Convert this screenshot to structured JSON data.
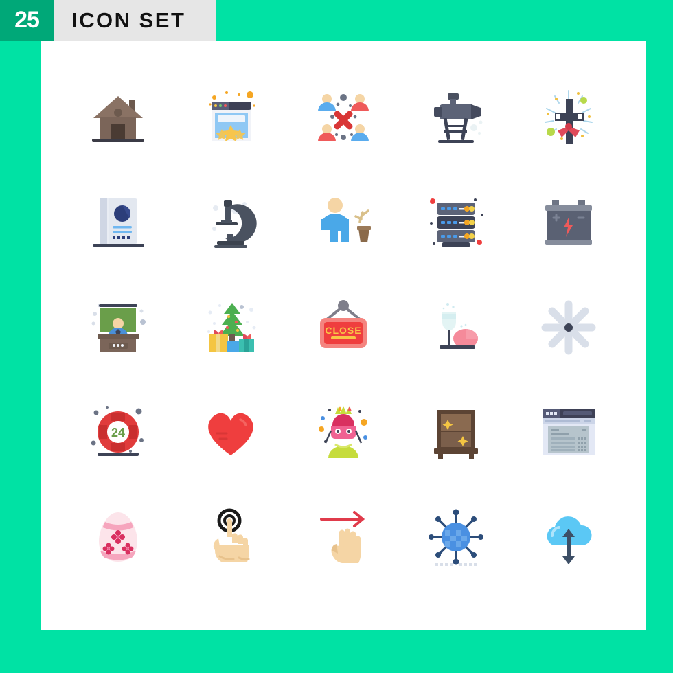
{
  "header": {
    "count": "25",
    "title": "ICON SET",
    "badge_color": "#00a878",
    "band_color": "#e6e6e6",
    "page_background": "#00e2a4",
    "panel_color": "#ffffff"
  },
  "grid": {
    "columns": 5,
    "rows": 5,
    "total": 25,
    "icons": [
      {
        "name": "house-icon",
        "label": "House",
        "colors": [
          "#7b6559",
          "#4a3b33",
          "#3b3b46"
        ]
      },
      {
        "name": "browser-rating-icon",
        "label": "Browser Rating Stars",
        "colors": [
          "#f1f3f8",
          "#3e4156",
          "#6fb7f0",
          "#f7c54d"
        ]
      },
      {
        "name": "group-disconnect-icon",
        "label": "Group Disconnect",
        "colors": [
          "#5aacee",
          "#ef5a5a",
          "#f5d5a5",
          "#d93636"
        ]
      },
      {
        "name": "telescope-icon",
        "label": "Telescope",
        "colors": [
          "#5c6377",
          "#454b5e",
          "#3d4356"
        ]
      },
      {
        "name": "decorated-cross-icon",
        "label": "Decorated Cross",
        "colors": [
          "#3d4356",
          "#e04a5a",
          "#b8d94a",
          "#f0c040"
        ]
      },
      {
        "name": "book-profile-icon",
        "label": "Profile Book",
        "colors": [
          "#cfd6e4",
          "#e3e8f0",
          "#2c3e7a",
          "#6fb7f0"
        ]
      },
      {
        "name": "microscope-icon",
        "label": "Microscope",
        "colors": [
          "#4a5260",
          "#3c434f",
          "#e6ebf2"
        ]
      },
      {
        "name": "person-plant-icon",
        "label": "Person with Plant",
        "colors": [
          "#4aa8e8",
          "#f5d5a5",
          "#8a6a4a",
          "#d9c08a"
        ]
      },
      {
        "name": "server-rack-icon",
        "label": "Server Rack",
        "colors": [
          "#5c6377",
          "#3d4356",
          "#4a9ae8",
          "#f5a623",
          "#f2d14a"
        ]
      },
      {
        "name": "car-battery-icon",
        "label": "Car Battery",
        "colors": [
          "#6e7585",
          "#5a6173",
          "#ef5a5a"
        ]
      },
      {
        "name": "teacher-desk-icon",
        "label": "Teacher at Desk",
        "colors": [
          "#7b6559",
          "#6a9e4a",
          "#4a90d9",
          "#f5d5a5"
        ]
      },
      {
        "name": "christmas-gifts-icon",
        "label": "Christmas Tree Gifts",
        "colors": [
          "#4caf50",
          "#f4c542",
          "#4aa8e8",
          "#3bbfb0",
          "#e04a5a"
        ]
      },
      {
        "name": "close-sign-icon",
        "label": "Close Sign",
        "text": "CLOSE",
        "colors": [
          "#f4635f",
          "#ef3e3e",
          "#f9c646",
          "#7e7e8a"
        ]
      },
      {
        "name": "champagne-egg-icon",
        "label": "Champagne Glass and Egg",
        "colors": [
          "#e3f4f4",
          "#f58a9a",
          "#3d4356"
        ]
      },
      {
        "name": "asterisk-star-icon",
        "label": "Asterisk Star",
        "colors": [
          "#d9dfe9",
          "#3d4356"
        ]
      },
      {
        "name": "lifebuoy-24-icon",
        "label": "24 Hour Lifebuoy",
        "text": "24",
        "colors": [
          "#e03b3b",
          "#c92f2f",
          "#ffffff",
          "#6a9e4a",
          "#3d4356"
        ]
      },
      {
        "name": "heart-icon",
        "label": "Heart",
        "colors": [
          "#ef3e3e",
          "#d93636"
        ]
      },
      {
        "name": "carnival-woman-icon",
        "label": "Carnival Woman",
        "colors": [
          "#f06292",
          "#c6dc3c",
          "#f5d5a5",
          "#f5a623",
          "#3d4356"
        ]
      },
      {
        "name": "wooden-cabinet-icon",
        "label": "Wooden Cabinet",
        "colors": [
          "#7b5f4b",
          "#5c4434",
          "#f4c542"
        ]
      },
      {
        "name": "browser-table-icon",
        "label": "Browser Table",
        "colors": [
          "#e3e8f5",
          "#3e4156",
          "#b6c4cc",
          "#ffffff"
        ]
      },
      {
        "name": "easter-egg-icon",
        "label": "Decorated Easter Egg",
        "colors": [
          "#fce4ea",
          "#f6a5bd",
          "#d93060"
        ]
      },
      {
        "name": "tap-gesture-icon",
        "label": "Tap Gesture",
        "colors": [
          "#f5d5a5",
          "#e8c28c",
          "#1a1a1a"
        ]
      },
      {
        "name": "swipe-right-icon",
        "label": "Swipe Right Gesture",
        "colors": [
          "#f5d5a5",
          "#e8c28c",
          "#e03b4b"
        ]
      },
      {
        "name": "global-network-icon",
        "label": "Global Network",
        "colors": [
          "#4a90e2",
          "#2c4d7a",
          "#d9dfe9"
        ]
      },
      {
        "name": "cloud-sync-icon",
        "label": "Cloud Sync",
        "colors": [
          "#5bc8f5",
          "#3d4f66"
        ]
      }
    ]
  }
}
